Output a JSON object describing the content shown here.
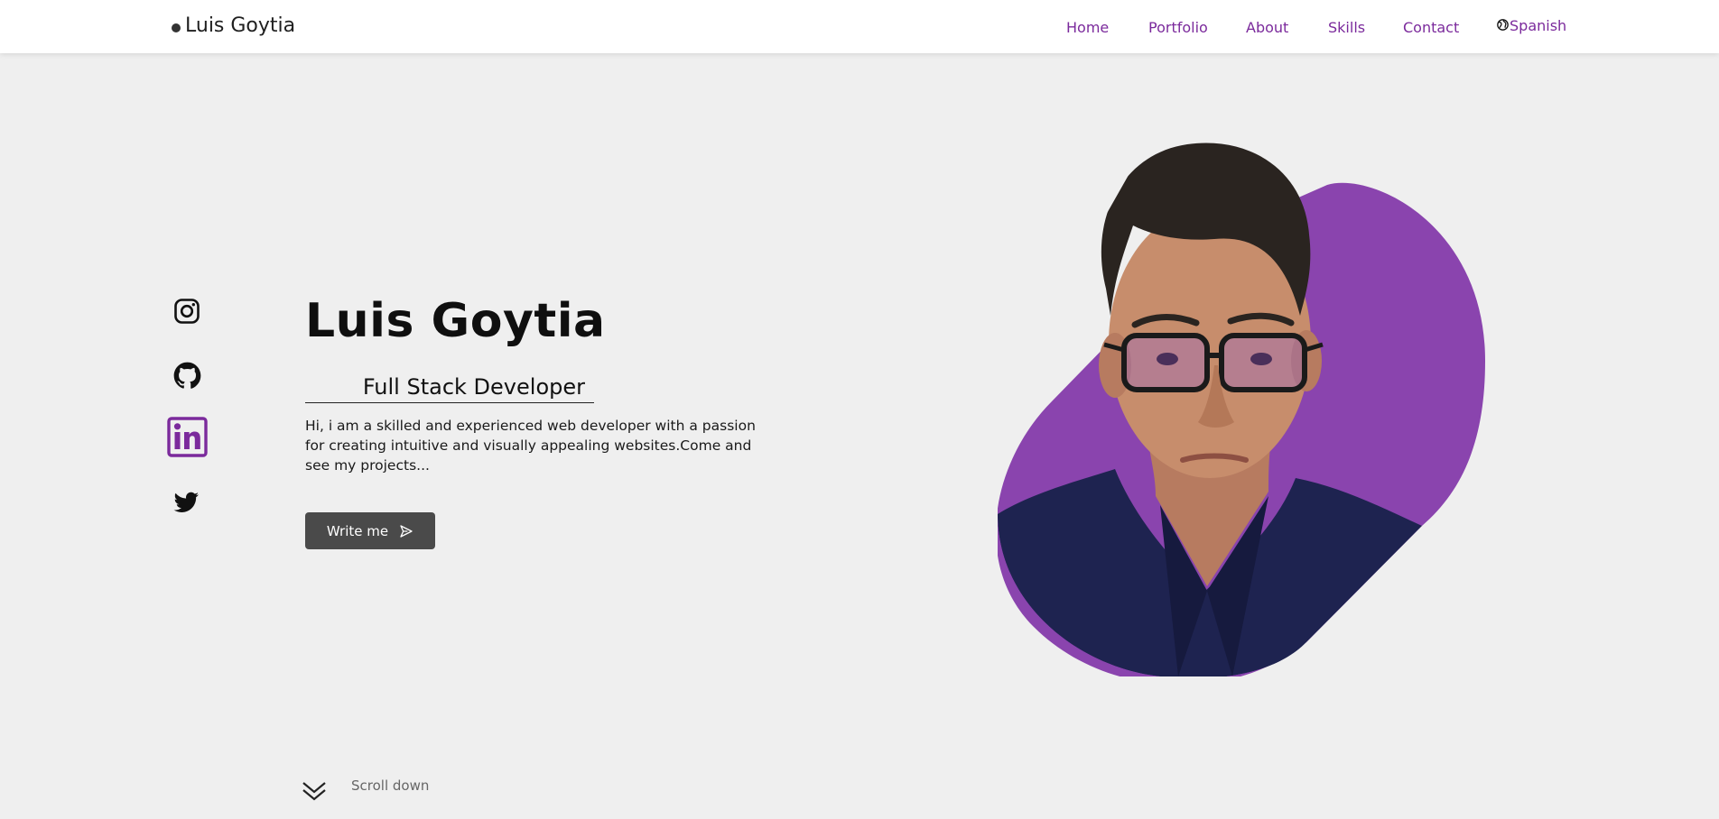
{
  "header": {
    "brand": "Luis Goytia",
    "nav": [
      {
        "label": "Home"
      },
      {
        "label": "Portfolio"
      },
      {
        "label": "About"
      },
      {
        "label": "Skills"
      },
      {
        "label": "Contact"
      }
    ],
    "language": "Spanish"
  },
  "social": [
    {
      "icon": "instagram-icon"
    },
    {
      "icon": "github-icon"
    },
    {
      "icon": "linkedin-icon"
    },
    {
      "icon": "twitter-icon"
    }
  ],
  "hero": {
    "title": "Luis Goytia",
    "subtitle": "Full Stack Developer",
    "description": "Hi, i am a skilled and experienced web developer with a passion for creating intuitive and visually appealing websites.Come and see my projects...",
    "cta": "Write me",
    "scroll_label": "Scroll down"
  },
  "colors": {
    "accent": "#7b2a9c",
    "blob": "#8a44ae",
    "button": "#4a4a4a",
    "background": "#efefef"
  }
}
